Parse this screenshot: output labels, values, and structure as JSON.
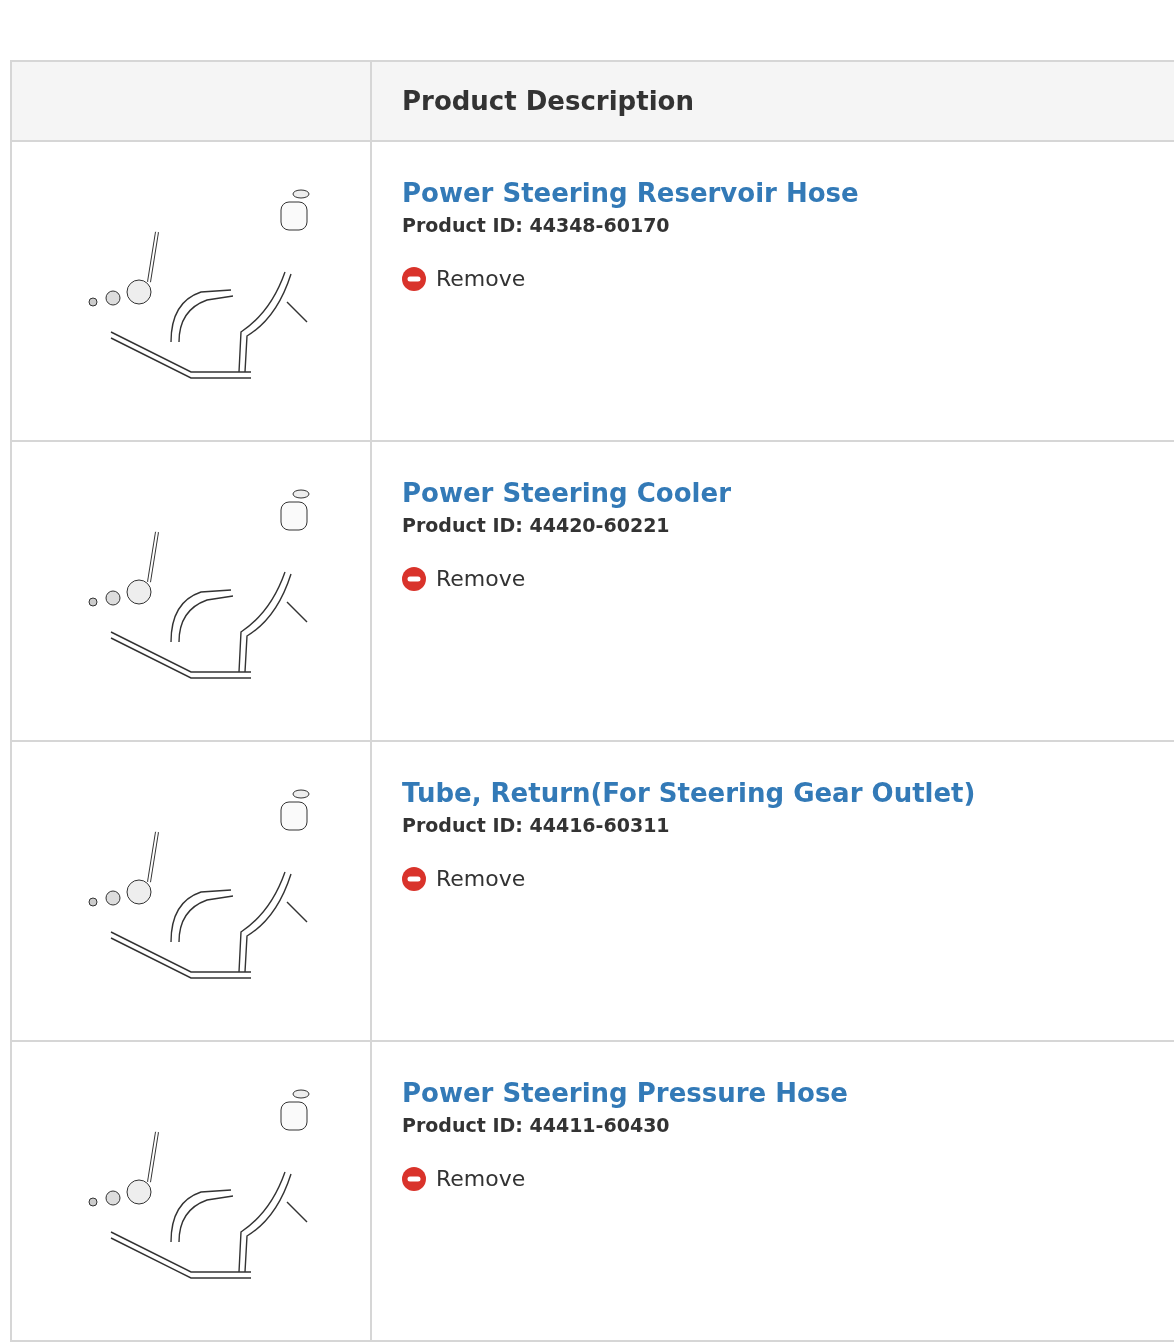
{
  "table": {
    "header": "Product Description",
    "rows": [
      {
        "title": "Power Steering Reservoir Hose",
        "product_id": "Product ID: 44348-60170",
        "action": "Remove"
      },
      {
        "title": "Power Steering Cooler",
        "product_id": "Product ID: 44420-60221",
        "action": "Remove"
      },
      {
        "title": "Tube, Return(For Steering Gear Outlet)",
        "product_id": "Product ID: 44416-60311",
        "action": "Remove"
      },
      {
        "title": "Power Steering Pressure Hose",
        "product_id": "Product ID: 44411-60430",
        "action": "Remove"
      }
    ]
  }
}
